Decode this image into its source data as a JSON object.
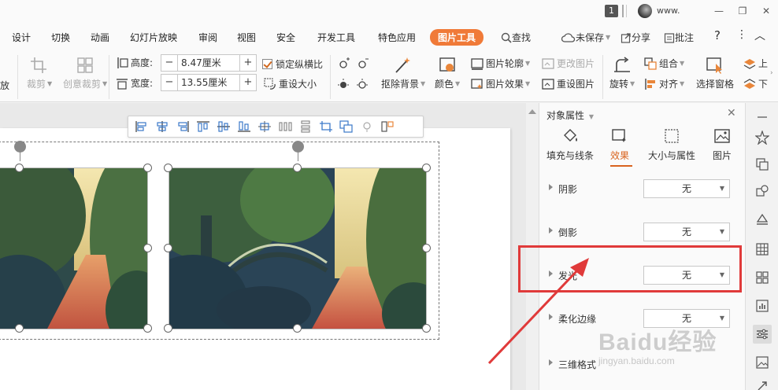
{
  "titlebar": {
    "badge": "1",
    "user": "www.",
    "minimize_glyph": "—",
    "restore_glyph": "❐",
    "close_glyph": "✕"
  },
  "ribbon": {
    "tabs": [
      "设计",
      "切换",
      "动画",
      "幻灯片放映",
      "审阅",
      "视图",
      "安全",
      "开发工具",
      "特色应用"
    ],
    "active_tab": "图片工具",
    "search": "查找",
    "unsaved": "未保存",
    "share": "分享",
    "comment": "批注",
    "help": "?",
    "more": "⋮",
    "collapse": "︿"
  },
  "toolbar": {
    "zoom_partial": "放",
    "crop": "裁剪",
    "creative_crop": "创意裁剪",
    "height_label": "高度:",
    "height_value": "8.47厘米",
    "width_label": "宽度:",
    "width_value": "13.55厘米",
    "lock_ratio": "锁定纵横比",
    "reset_size": "重设大小",
    "remove_bg": "抠除背景",
    "color": "颜色",
    "picture_outline": "图片轮廓",
    "picture_effect": "图片效果",
    "change_picture": "更改图片",
    "reset_picture": "重设图片",
    "rotate": "旋转",
    "group": "组合",
    "align": "对齐",
    "selection_pane": "选择窗格",
    "up": "上",
    "down": "下"
  },
  "panel": {
    "title": "对象属性",
    "tabs": [
      "填充与线条",
      "效果",
      "大小与属性",
      "图片"
    ],
    "active_tab_index": 1,
    "rows": [
      {
        "label": "阴影",
        "value": "无"
      },
      {
        "label": "倒影",
        "value": "无"
      },
      {
        "label": "发光",
        "value": "无"
      },
      {
        "label": "柔化边缘",
        "value": "无"
      },
      {
        "label": "三维格式",
        "value": ""
      }
    ]
  },
  "watermark": {
    "brand": "Baidu经验",
    "url": "jingyan.baidu.com"
  },
  "colors": {
    "accent": "#f07a38",
    "active_tab_text": "#d9631e",
    "highlight_box": "#e03a3a"
  }
}
